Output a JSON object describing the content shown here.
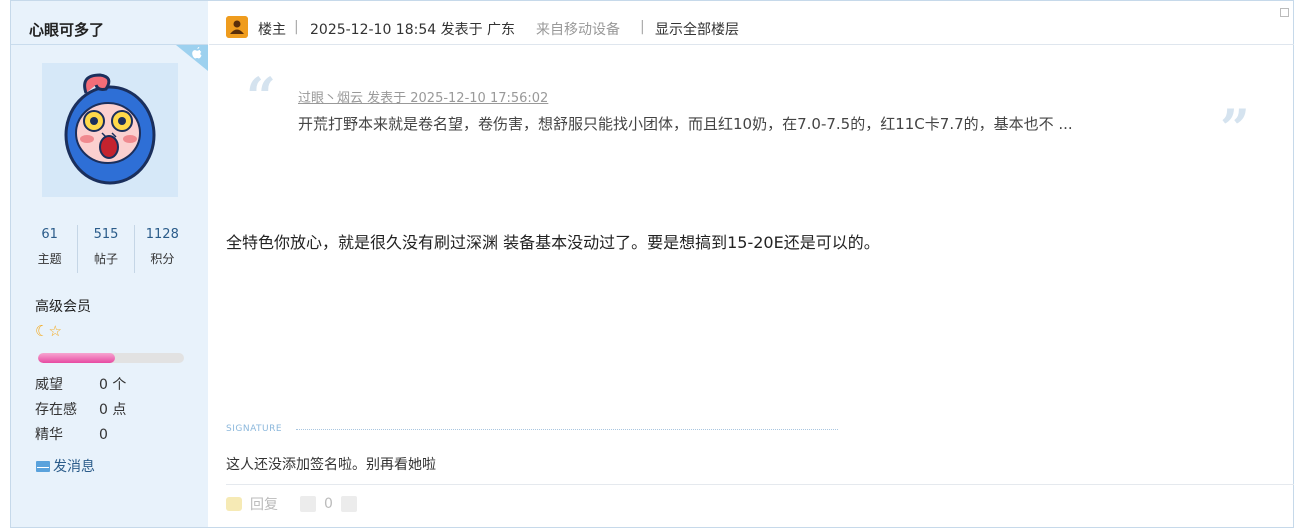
{
  "user": {
    "name": "心眼可多了",
    "stats": [
      {
        "value": "61",
        "label": "主题"
      },
      {
        "value": "515",
        "label": "帖子"
      },
      {
        "value": "1128",
        "label": "积分"
      }
    ],
    "level": "高级会员",
    "level_icons": "☾☆",
    "progress_fraction": 0.53,
    "meta": [
      {
        "key": "威望",
        "value": "0 个"
      },
      {
        "key": "存在感",
        "value": "0 点"
      },
      {
        "key": "精华",
        "value": "0"
      }
    ],
    "send_message": "发消息"
  },
  "header": {
    "role": "楼主",
    "datetime": "2025-12-10 18:54 发表于 广东",
    "device": "来自移动设备",
    "show_all": "显示全部楼层"
  },
  "quote": {
    "author": "过眼丶烟云 发表于 2025-12-10 17:56:02",
    "text": "开荒打野本来就是卷名望，卷伤害，想舒服只能找小团体，而且红10奶，在7.0-7.5的，红11C卡7.7的，基本也不 ..."
  },
  "post": {
    "body": "全特色你放心，就是很久没有刷过深渊 装备基本没动过了。要是想搞到15-20E还是可以的。"
  },
  "signature": {
    "label": "SIGNATURE",
    "text": "这人还没添加签名啦。别再看她啦"
  },
  "footer": {
    "reply": "回复",
    "like_count": "0"
  },
  "colors": {
    "sidebar_bg": "#e8f2fb",
    "link": "#2b5c8a",
    "progress": "#e74aa2"
  }
}
